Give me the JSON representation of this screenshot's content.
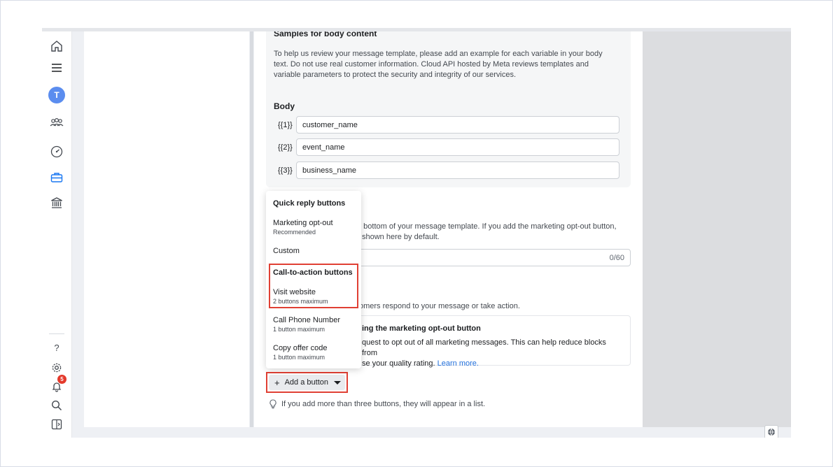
{
  "sidebar": {
    "avatar_letter": "T",
    "notifications_count": "5",
    "help_label": "?"
  },
  "samples": {
    "title": "Samples for body content",
    "description": "To help us review your message template, please add an example for each variable in your body text. Do not use real customer information. Cloud API hosted by Meta reviews templates and variable parameters to protect the security and integrity of our services.",
    "body_label": "Body",
    "variables": [
      {
        "key": "{{1}}",
        "value": "customer_name"
      },
      {
        "key": "{{2}}",
        "value": "event_name"
      },
      {
        "key": "{{3}}",
        "value": "business_name"
      }
    ]
  },
  "buttons_section": {
    "desc_line1": "e bottom of your message template. If you add the marketing opt-out button,",
    "desc_line2": "shown here by default.",
    "text_counter": "0/60",
    "help_text": "omers respond to your message or take action.",
    "optout_title": "ing the marketing opt-out button",
    "optout_desc_line1": "quest to opt out of all marketing messages. This can help reduce blocks from",
    "optout_desc_line2": "se your quality rating.",
    "learn_more": "Learn more.",
    "add_button_label": "Add a button",
    "list_hint": "If you add more than three buttons, they will appear in a list."
  },
  "menu": {
    "quick_reply_header": "Quick reply buttons",
    "marketing_optout": "Marketing opt-out",
    "marketing_optout_sub": "Recommended",
    "custom": "Custom",
    "cta_header": "Call-to-action buttons",
    "visit_website": "Visit website",
    "visit_website_sub": "2 buttons maximum",
    "call_phone": "Call Phone Number",
    "call_phone_sub": "1 button maximum",
    "copy_offer": "Copy offer code",
    "copy_offer_sub": "1 button maximum"
  }
}
